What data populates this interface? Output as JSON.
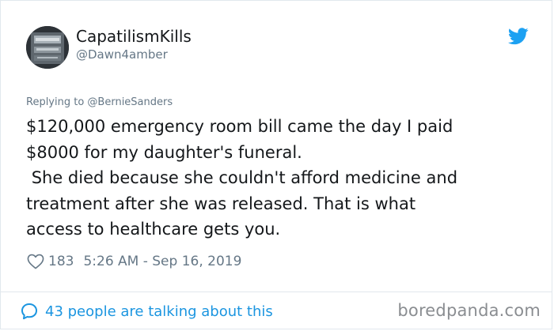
{
  "user": {
    "display_name": "CapatilismKills",
    "handle": "@Dawn4amber"
  },
  "tweet": {
    "replying_to": "Replying to @BernieSanders",
    "text": "$120,000 emergency room bill came the day I paid\n$8000 for my daughter's funeral.\n She died because she couldn't afford medicine and\ntreatment after she was released. That is what\naccess to healthcare gets you.",
    "like_count": "183",
    "timestamp": "5:26 AM - Sep 16, 2019"
  },
  "footer": {
    "talking_label": "43 people are talking about this",
    "watermark": "boredpanda.com"
  },
  "colors": {
    "twitter_blue": "#1da1f2",
    "link_blue": "#1b95e0",
    "secondary_gray": "#657786",
    "text_dark": "#14171a",
    "border": "#e1e8ed"
  },
  "icons": {
    "brand": "twitter-bird-icon",
    "like": "heart-icon",
    "comments": "speech-bubble-icon"
  }
}
